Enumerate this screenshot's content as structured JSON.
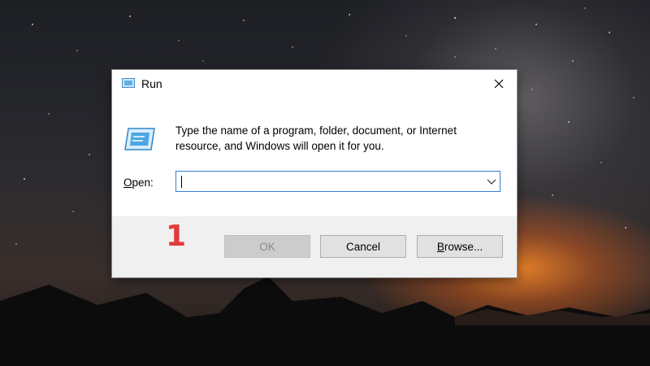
{
  "dialog": {
    "title": "Run",
    "description": "Type the name of a program, folder, document, or Internet resource, and Windows will open it for you.",
    "open_label_first": "O",
    "open_label_rest": "pen:",
    "open_value": "",
    "close_icon": "close-icon",
    "title_icon": "run-icon"
  },
  "annotation": {
    "step_number": "1",
    "color": "#e23b3b"
  },
  "buttons": {
    "ok": "OK",
    "cancel": "Cancel",
    "browse_first": "B",
    "browse_rest": "rowse..."
  },
  "colors": {
    "focus_border": "#3a7bd5",
    "footer_bg": "#f0f0f0",
    "disabled_text": "#8a8a8a"
  }
}
